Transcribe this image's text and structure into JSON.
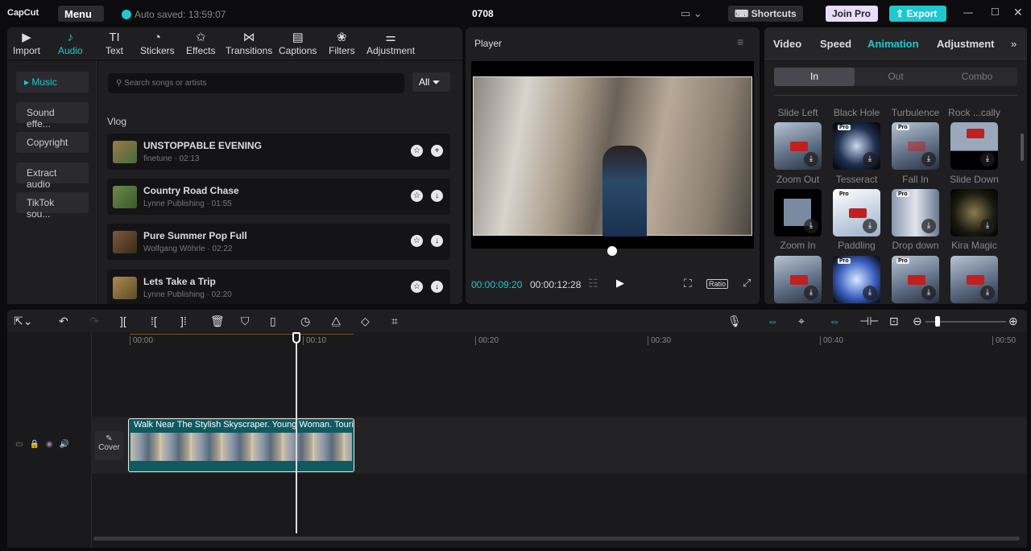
{
  "topbar": {
    "logo": "CapCut",
    "menu": "Menu",
    "autosaved": "Auto saved: 13:59:07",
    "title": "0708",
    "shortcuts": "Shortcuts",
    "join_pro": "Join Pro",
    "export": "Export"
  },
  "toolbar": [
    {
      "label": "Import",
      "icon": "▶"
    },
    {
      "label": "Audio",
      "icon": "♪"
    },
    {
      "label": "Text",
      "icon": "TI"
    },
    {
      "label": "Stickers",
      "icon": "◔"
    },
    {
      "label": "Effects",
      "icon": "✩"
    },
    {
      "label": "Transitions",
      "icon": "⋈"
    },
    {
      "label": "Captions",
      "icon": "▤"
    },
    {
      "label": "Filters",
      "icon": "❀"
    },
    {
      "label": "Adjustment",
      "icon": "⚌"
    }
  ],
  "sidebar": [
    "Music",
    "Sound effe...",
    "Copyright",
    "Extract audio",
    "TikTok sou..."
  ],
  "search": {
    "placeholder": "Search songs or artists",
    "filter": "All"
  },
  "section": "Vlog",
  "songs": [
    {
      "title": "UNSTOPPABLE EVENING",
      "sub": "finetune · 02:13",
      "action": "+"
    },
    {
      "title": "Country Road Chase",
      "sub": "Lynne Publishing · 01:55",
      "action": "↓"
    },
    {
      "title": "Pure Summer Pop Full",
      "sub": "Wolfgang Wöhrle · 02:22",
      "action": "↓"
    },
    {
      "title": "Lets Take a Trip",
      "sub": "Lynne Publishing · 02:20",
      "action": "↓"
    }
  ],
  "player": {
    "title": "Player",
    "current": "00:00:09:20",
    "total": "00:00:12:28",
    "ratio": "Ratio"
  },
  "right": {
    "tabs": [
      "Video",
      "Speed",
      "Animation",
      "Adjustment"
    ],
    "seg": [
      "In",
      "Out",
      "Combo"
    ],
    "top_labels": [
      "Slide Left",
      "Black Hole",
      "Turbulence",
      "Rock ...cally"
    ],
    "rows": [
      [
        "Zoom Out",
        "Tesseract",
        "Fall In",
        "Slide Down"
      ],
      [
        "Zoom In",
        "Paddling",
        "Drop down",
        "Kira Magic"
      ]
    ]
  },
  "timeline": {
    "ticks": [
      "00:00",
      "00:10",
      "00:20",
      "00:30",
      "00:40",
      "00:50"
    ],
    "clip": "Walk Near The Stylish Skyscraper. Young Woman. Touris",
    "cover": "Cover"
  }
}
